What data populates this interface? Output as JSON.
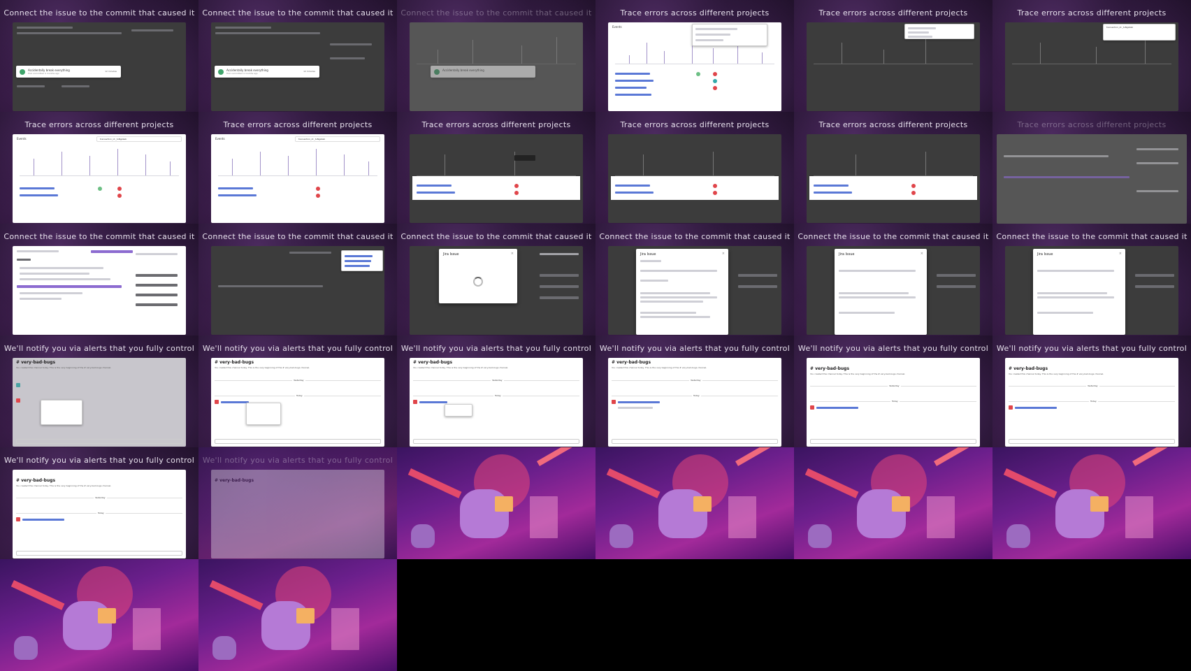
{
  "captions": {
    "commit": "Connect the issue to the commit that caused it",
    "trace": "Trace errors across different projects",
    "alerts": "We'll notify you via alerts that you fully control",
    "overlap_commit_trace": "Connect the issue to the commit that caused it",
    "overlap_trace_commit": "Trace errors across different projects"
  },
  "app": {
    "brand": "Events"
  },
  "toast": {
    "title": "Accidentally break everything",
    "subtitle": "first committed 4 months ago",
    "button": "12 minutes"
  },
  "search": {
    "value": "transaction_id:_tuNgs9ab"
  },
  "jira": {
    "title": "Jira Issue",
    "close": "×"
  },
  "slack": {
    "channel": "# very-bad-bugs",
    "intro": "You created this channel today. This is the very beginning of the # very-bad-bugs channel.",
    "yesterday": "Yesterday",
    "today": "Today"
  },
  "icons": [
    "search-icon",
    "close-icon",
    "spinner-icon",
    "avatar-icon",
    "robot-illustration"
  ],
  "colors": {
    "background": "#2b1738",
    "accent": "#6c5fc7",
    "ok": "#3fa46b",
    "error": "#e0454a",
    "illustration": "#a22a9a"
  }
}
